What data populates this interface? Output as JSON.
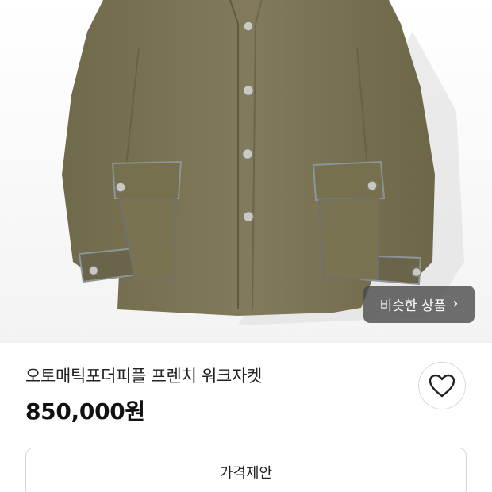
{
  "product": {
    "image_alt": "",
    "title": "오토매틱포더피플 프렌치 워크자켓",
    "price": "850,000원"
  },
  "actions": {
    "similar_label": "비슷한 상품",
    "similar_chevron": "›",
    "offer_label": "가격제안"
  },
  "colors": {
    "jacket": "#7d7656",
    "overlay_button": "#464646",
    "border": "#d6d6d6"
  }
}
